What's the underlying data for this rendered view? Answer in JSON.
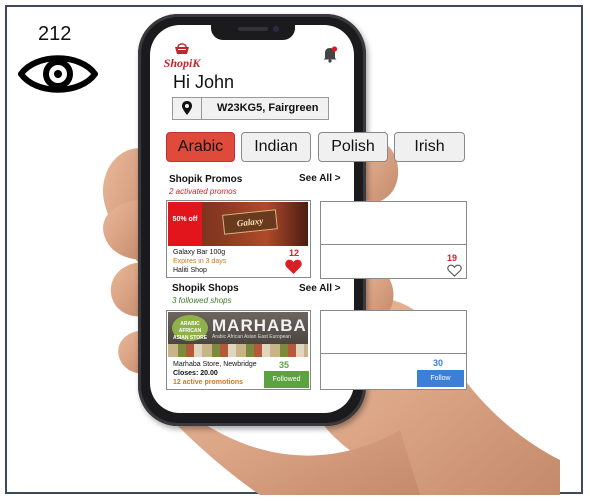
{
  "view_counter": {
    "count": "212",
    "icon": "eye-icon"
  },
  "app": {
    "brand": "ShopiK",
    "greeting": "Hi John",
    "location": "W23KG5, Fairgreen",
    "categories": [
      {
        "label": "Arabic",
        "active": true
      },
      {
        "label": "Indian",
        "active": false
      },
      {
        "label": "Polish",
        "active": false
      },
      {
        "label": "Irish",
        "active": false
      }
    ],
    "promos": {
      "title": "Shopik Promos",
      "see_all": "See All >",
      "subtitle": "2 activated promos",
      "card": {
        "badge": "50% off",
        "image_text": "Galaxy",
        "product": "Galaxy Bar 100g",
        "expiry": "Expires in 3 days",
        "shop": "Haliti Shop",
        "likes": "12"
      },
      "card2": {
        "likes": "19"
      }
    },
    "shops": {
      "title": "Shopik Shops",
      "see_all": "See All >",
      "subtitle": "3 followed shops",
      "card": {
        "logo_text": "ARABIC AFRICAN ASIAN STORE",
        "sign_name": "MARHABA",
        "sign_tag": "Arabic   African   Asian   East European",
        "name": "Marhaba Store, Newbridge",
        "closes": "Closes: 20.00",
        "promotions": "12 active promotions",
        "followers": "35",
        "button": "Followed"
      },
      "card2": {
        "followers": "30",
        "button": "Follow"
      }
    }
  },
  "colors": {
    "brand_red": "#c0272d",
    "active_category": "#e04a3a",
    "followed_green": "#5aa33e",
    "follow_blue": "#3d7fd6",
    "promo_subtitle": "#d61f26",
    "shop_subtitle": "#3f7a2a"
  }
}
